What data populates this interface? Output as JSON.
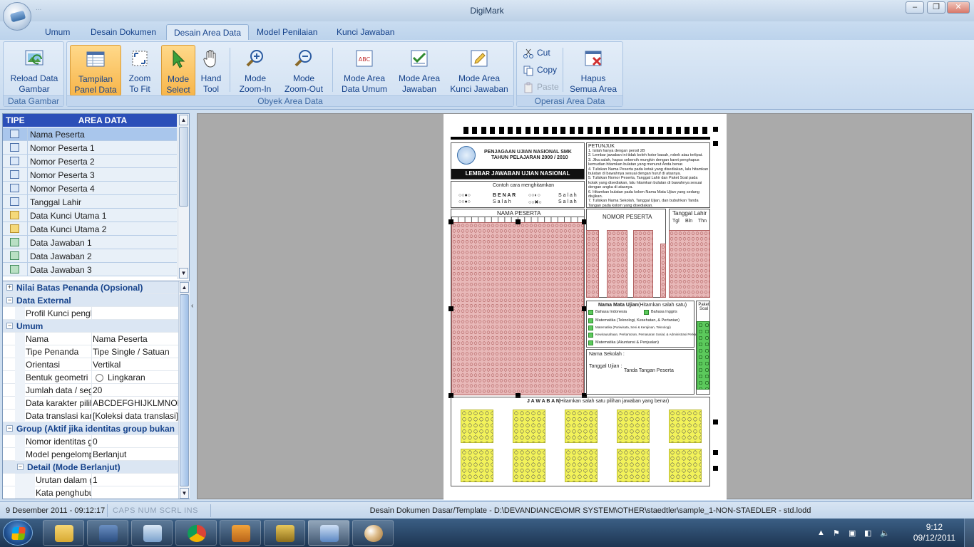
{
  "window": {
    "title": "DigiMark",
    "qat": "...",
    "controls": [
      "–",
      "❐",
      "✕"
    ]
  },
  "tabs": [
    {
      "label": "Umum"
    },
    {
      "label": "Desain Dokumen"
    },
    {
      "label": "Desain Area Data"
    },
    {
      "label": "Model Penilaian"
    },
    {
      "label": "Kunci Jawaban"
    }
  ],
  "ribbon": {
    "groups": {
      "data_gambar": "Data Gambar",
      "obyek_area_data": "Obyek Area Data",
      "operasi_area_data": "Operasi Area Data"
    },
    "buttons": {
      "reload": [
        "Reload Data",
        "Gambar"
      ],
      "tampilan": [
        "Tampilan",
        "Panel Data"
      ],
      "zoomfit": [
        "Zoom",
        "To Fit"
      ],
      "modeselect": [
        "Mode",
        "Select"
      ],
      "handtool": [
        "Hand",
        "Tool"
      ],
      "zoomin": [
        "Mode",
        "Zoom-In"
      ],
      "zoomout": [
        "Mode",
        "Zoom-Out"
      ],
      "areaumum": [
        "Mode Area",
        "Data Umum"
      ],
      "areajawaban": [
        "Mode Area",
        "Jawaban"
      ],
      "areakunci": [
        "Mode Area",
        "Kunci Jawaban"
      ],
      "hapus": [
        "Hapus",
        "Semua Area"
      ]
    },
    "small": {
      "cut": "Cut",
      "copy": "Copy",
      "paste": "Paste"
    }
  },
  "grid": {
    "headers": {
      "tipe": "TIPE",
      "area": "AREA DATA"
    },
    "rows": [
      {
        "label": "Nama Peserta",
        "kind": "umum"
      },
      {
        "label": "Nomor Peserta 1",
        "kind": "umum"
      },
      {
        "label": "Nomor Peserta 2",
        "kind": "umum"
      },
      {
        "label": "Nomor Peserta 3",
        "kind": "umum"
      },
      {
        "label": "Nomor Peserta 4",
        "kind": "umum"
      },
      {
        "label": "Tanggal Lahir",
        "kind": "umum"
      },
      {
        "label": "Data Kunci Utama 1",
        "kind": "kunci"
      },
      {
        "label": "Data Kunci Utama 2",
        "kind": "kunci"
      },
      {
        "label": "Data Jawaban 1",
        "kind": "jawaban"
      },
      {
        "label": "Data Jawaban 2",
        "kind": "jawaban"
      },
      {
        "label": "Data Jawaban 3",
        "kind": "jawaban"
      }
    ]
  },
  "props": {
    "cat_nilai": "Nilai Batas Penanda (Opsional)",
    "cat_external": "Data External",
    "profil_name": "Profil Kunci pengh",
    "profil_val": "",
    "cat_umum": "Umum",
    "nama_name": "Nama",
    "nama_val": "Nama Peserta",
    "tipe_name": "Tipe Penanda",
    "tipe_val": "Tipe Single / Satuan",
    "orient_name": "Orientasi",
    "orient_val": "Vertikal",
    "bentuk_name": "Bentuk geometri",
    "bentuk_val": "Lingkaran",
    "jumlah_name": "Jumlah data / segr",
    "jumlah_val": "20",
    "karakter_name": "Data karakter pilih",
    "karakter_val": "ABCDEFGHIJKLMNOPQ",
    "translasi_name": "Data translasi kara",
    "translasi_val": "[Koleksi data translasi]",
    "cat_group": "Group (Aktif jika identitas group bukan",
    "nomor_name": "Nomor identitas gr",
    "nomor_val": "0",
    "model_name": "Model pengelompo",
    "model_val": "Berlanjut",
    "cat_detail": "Detail (Mode Berlanjut)",
    "urutan_name": "Urutan dalam gr",
    "urutan_val": "1",
    "kata_name": "Kata penghubu",
    "kata_val": ""
  },
  "sheet": {
    "header_title": "PENJAGAAN UJIAN NASIONAL SMK",
    "header_year": "TAHUN PELAJARAN 2009 / 2010",
    "banner": "LEMBAR JAWABAN UJIAN NASIONAL",
    "petunjuk_title": "PETUNJUK",
    "petunjuk_lines": [
      "1. Isilah hanya dengan pensil 2B",
      "2. Lembar jawaban ini tidak boleh kotor basah, robek atau terlipat.",
      "3. Jika salah, hapus sebersih mungkin dengan karet penghapus",
      "   kemudian hitamkan bulatan yang menurut Anda benar.",
      "4. Tuliskan Nama Peserta pada kotak yang disediakan, lalu hitamkan",
      "   bulatan di bawahnya sesuai dengan huruf di atasnya.",
      "5. Tuliskan Nomor Peserta, Tanggal Lahir dan Paket Soal pada",
      "   kotak yang disediakan, lalu hitamkan bulatan di bawahnya sesuai",
      "   dengan angka di atasnya.",
      "6. Hitamkan bulatan pada kolom Nama Mata Ujian yang sedang",
      "   diujikan.",
      "7. Tuliskan Nama Sekolah, Tanggal Ujian, dan bubuhkan Tanda",
      "   Tangan pada kolom yang disediakan."
    ],
    "contoh": "Contoh cara menghitamkan",
    "benar": "B E N A R",
    "salah": "S a l a h",
    "nama_peserta": "NAMA PESERTA",
    "nomor_peserta": "NOMOR PESERTA",
    "tanggal_lahir": "Tanggal Lahir",
    "tgl": "Tgl",
    "bln": "Bln",
    "thn": "Thn",
    "mata_ujian": "Nama Mata Ujian",
    "mata_ujian_hint": "(Hitamkan salah satu)",
    "paket_soal": "Paket Soal",
    "subjects": [
      "Bahasa Indonesia",
      "Bahasa Inggris",
      "Matematika (Teknologi, Kesehatan, & Pertanian)",
      "Matematika (Pariwisata, Seni & Kerajinan, Teknologi)",
      "Kewirausahaan, Perkantoran, Pemasaran Sosial, & Administrasi Perkantoran",
      "Matematika (Akuntansi & Penjualan)"
    ],
    "nama_sekolah": "Nama Sekolah :",
    "tanggal_ujian": "Tanggal Ujian :",
    "tanda_tangan": "Tanda Tangan Peserta",
    "jawaban": "J A W A B A N",
    "jawaban_hint": "(Hitamkan salah satu pilihan jawaban yang benar)"
  },
  "status": {
    "datetime": "9 Desember 2011 - 09:12:17",
    "keys": "CAPS  NUM  SCRL  INS",
    "path": "Desain Dokumen Dasar/Template - D:\\DEVANDIANCE\\OMR SYSTEM\\OTHER\\staedtler\\sample_1-NON-STAEDLER - std.lodd"
  },
  "taskbar": {
    "time": "9:12",
    "date": "09/12/2011",
    "apps": [
      "explorer",
      "media-center",
      "remote-desktop",
      "chrome",
      "winamp",
      "seven-app",
      "scanner",
      "paint"
    ]
  },
  "colors": {
    "accent": "#2b4fb8",
    "ribbon_selected": "#f7b54a",
    "area_pink": "#e8b8b8",
    "area_yellow": "#f2f25a",
    "area_green": "#5cc95c"
  }
}
